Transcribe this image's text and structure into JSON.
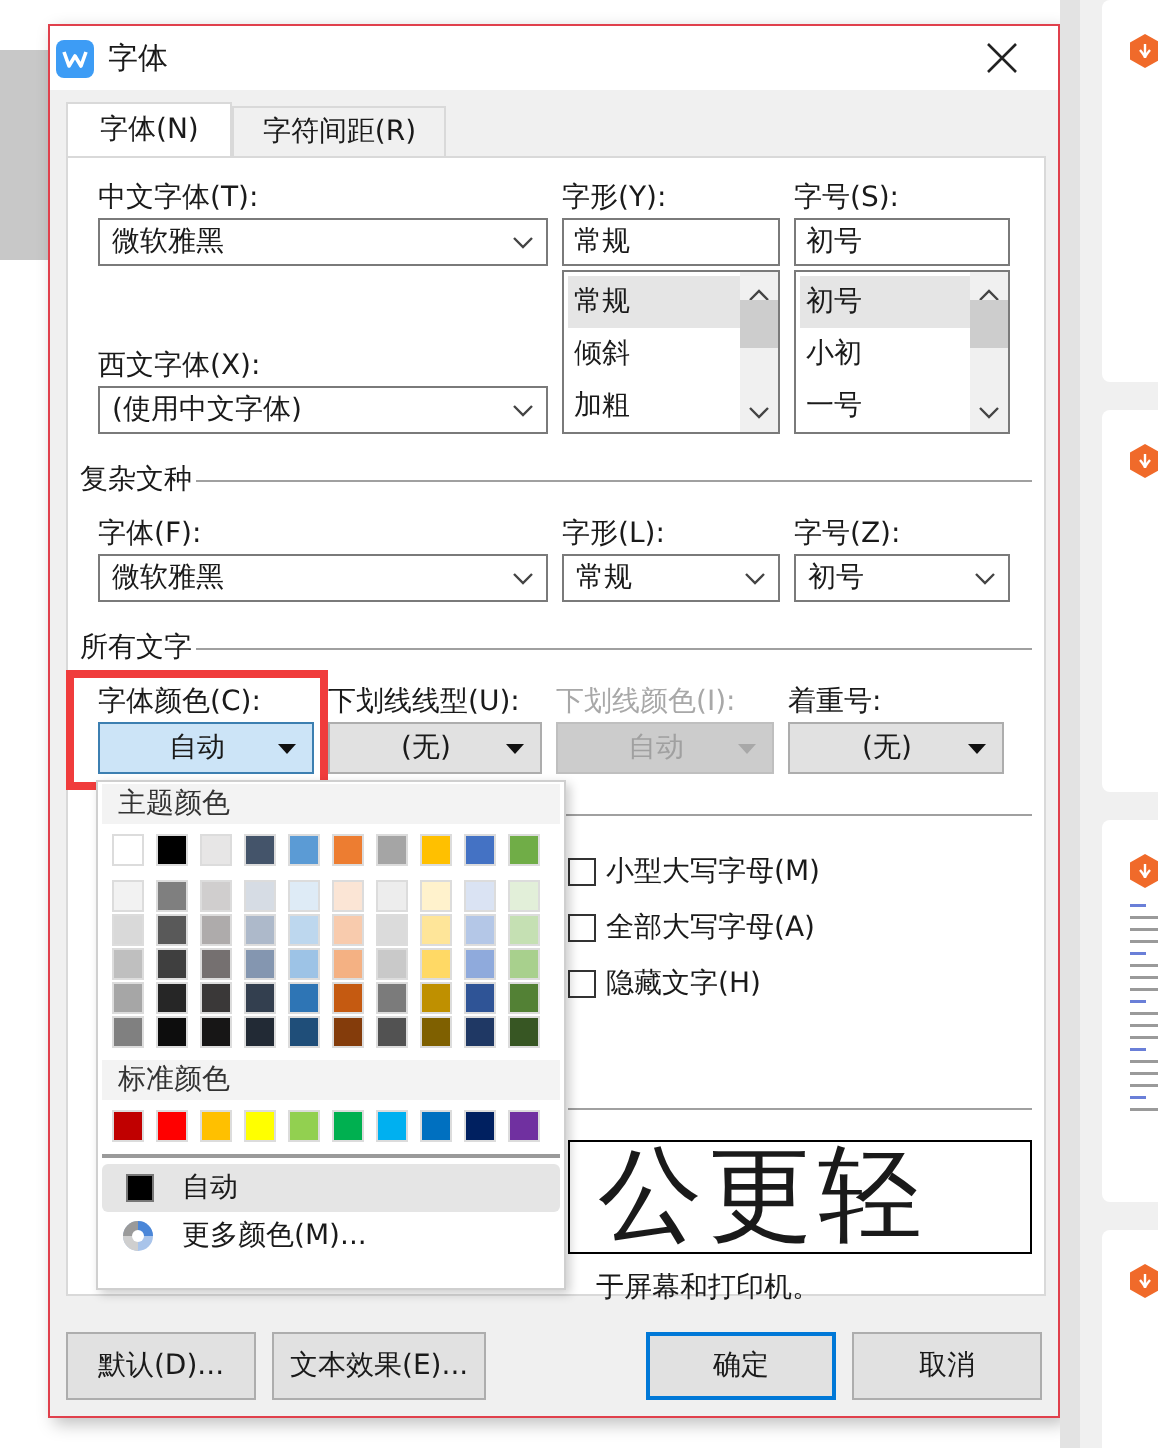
{
  "window": {
    "title": "字体"
  },
  "tabs": [
    {
      "label": "字体(N)",
      "selected": true
    },
    {
      "label": "字符间距(R)",
      "selected": false
    }
  ],
  "chinese_font": {
    "label": "中文字体(T):",
    "value": "微软雅黑"
  },
  "western_font": {
    "label": "西文字体(X):",
    "value": "(使用中文字体)"
  },
  "style": {
    "label": "字形(Y):",
    "value": "常规",
    "options": [
      {
        "label": "常规",
        "selected": true
      },
      {
        "label": "倾斜",
        "selected": false
      },
      {
        "label": "加粗",
        "selected": false
      }
    ]
  },
  "size": {
    "label": "字号(S):",
    "value": "初号",
    "options": [
      {
        "label": "初号",
        "selected": true
      },
      {
        "label": "小初",
        "selected": false
      },
      {
        "label": "一号",
        "selected": false
      }
    ]
  },
  "complex_script": {
    "heading": "复杂文种",
    "fields": [
      {
        "label": "字体(F):",
        "value": "微软雅黑"
      },
      {
        "label": "字形(L):",
        "value": "常规"
      },
      {
        "label": "字号(Z):",
        "value": "初号"
      }
    ]
  },
  "all_text": {
    "heading": "所有文字",
    "fields": [
      {
        "label": "字体颜色(C):",
        "value": "自动",
        "expanded": true,
        "disabled": false
      },
      {
        "label": "下划线线型(U):",
        "value": "(无)",
        "expanded": false,
        "disabled": false
      },
      {
        "label": "下划线颜色(I):",
        "value": "自动",
        "expanded": false,
        "disabled": true
      },
      {
        "label": "着重号:",
        "value": "(无)",
        "expanded": false,
        "disabled": false
      }
    ]
  },
  "effects": [
    {
      "label": "小型大写字母(M)",
      "checked": false
    },
    {
      "label": "全部大写字母(A)",
      "checked": false
    },
    {
      "label": "隐藏文字(H)",
      "checked": false
    }
  ],
  "preview": {
    "sample": "公更轻",
    "caption": "于屏幕和打印机。"
  },
  "buttons": [
    {
      "label": "默认(D)...",
      "default": false
    },
    {
      "label": "文本效果(E)...",
      "default": false
    },
    {
      "label": "确定",
      "default": true
    },
    {
      "label": "取消",
      "default": false
    }
  ],
  "color_popup": {
    "theme_heading": "主题颜色",
    "theme_colors": [
      {
        "color": "#ffffff"
      },
      {
        "color": "#000000"
      },
      {
        "color": "#e7e6e6"
      },
      {
        "color": "#44546a"
      },
      {
        "color": "#5b9bd5"
      },
      {
        "color": "#ed7d31"
      },
      {
        "color": "#a5a5a5"
      },
      {
        "color": "#ffc000"
      },
      {
        "color": "#4472c4"
      },
      {
        "color": "#70ad47"
      }
    ],
    "shade_rows": [
      {
        "swatches": [
          {
            "color": "#f2f2f2"
          },
          {
            "color": "#7f7f7f"
          },
          {
            "color": "#d0cece"
          },
          {
            "color": "#d6dce4"
          },
          {
            "color": "#deebf6"
          },
          {
            "color": "#fbe5d5"
          },
          {
            "color": "#ededed"
          },
          {
            "color": "#fff2cc"
          },
          {
            "color": "#dae3f3"
          },
          {
            "color": "#e2efd9"
          }
        ]
      },
      {
        "swatches": [
          {
            "color": "#d9d9d9"
          },
          {
            "color": "#595959"
          },
          {
            "color": "#aeabab"
          },
          {
            "color": "#adb9ca"
          },
          {
            "color": "#bdd7ee"
          },
          {
            "color": "#f8cbad"
          },
          {
            "color": "#dbdbdb"
          },
          {
            "color": "#fee599"
          },
          {
            "color": "#b4c7e7"
          },
          {
            "color": "#c5e0b3"
          }
        ]
      },
      {
        "swatches": [
          {
            "color": "#bfbfbf"
          },
          {
            "color": "#3f3f3f"
          },
          {
            "color": "#757070"
          },
          {
            "color": "#8496b0"
          },
          {
            "color": "#9dc3e6"
          },
          {
            "color": "#f4b183"
          },
          {
            "color": "#c9c9c9"
          },
          {
            "color": "#ffd965"
          },
          {
            "color": "#8faadc"
          },
          {
            "color": "#a8d08d"
          }
        ]
      },
      {
        "swatches": [
          {
            "color": "#a6a6a6"
          },
          {
            "color": "#262626"
          },
          {
            "color": "#3a3838"
          },
          {
            "color": "#333f4f"
          },
          {
            "color": "#2e75b5"
          },
          {
            "color": "#c55a11"
          },
          {
            "color": "#7b7b7b"
          },
          {
            "color": "#bf9000"
          },
          {
            "color": "#2f5496"
          },
          {
            "color": "#538135"
          }
        ]
      },
      {
        "swatches": [
          {
            "color": "#808080"
          },
          {
            "color": "#0d0d0d"
          },
          {
            "color": "#171616"
          },
          {
            "color": "#222a35"
          },
          {
            "color": "#1f4e79"
          },
          {
            "color": "#843c0b"
          },
          {
            "color": "#525252"
          },
          {
            "color": "#7f6000"
          },
          {
            "color": "#1f3864"
          },
          {
            "color": "#375623"
          }
        ]
      }
    ],
    "standard_heading": "标准颜色",
    "standard_colors": [
      {
        "color": "#c00000"
      },
      {
        "color": "#ff0000"
      },
      {
        "color": "#ffc000"
      },
      {
        "color": "#ffff00"
      },
      {
        "color": "#92d050"
      },
      {
        "color": "#00b050"
      },
      {
        "color": "#00b0f0"
      },
      {
        "color": "#0070c0"
      },
      {
        "color": "#002060"
      },
      {
        "color": "#7030a0"
      }
    ],
    "items": [
      {
        "kind": "automatic",
        "label": "自动",
        "selected": true
      },
      {
        "kind": "more",
        "label": "更多颜色(M)...",
        "selected": false
      }
    ]
  }
}
